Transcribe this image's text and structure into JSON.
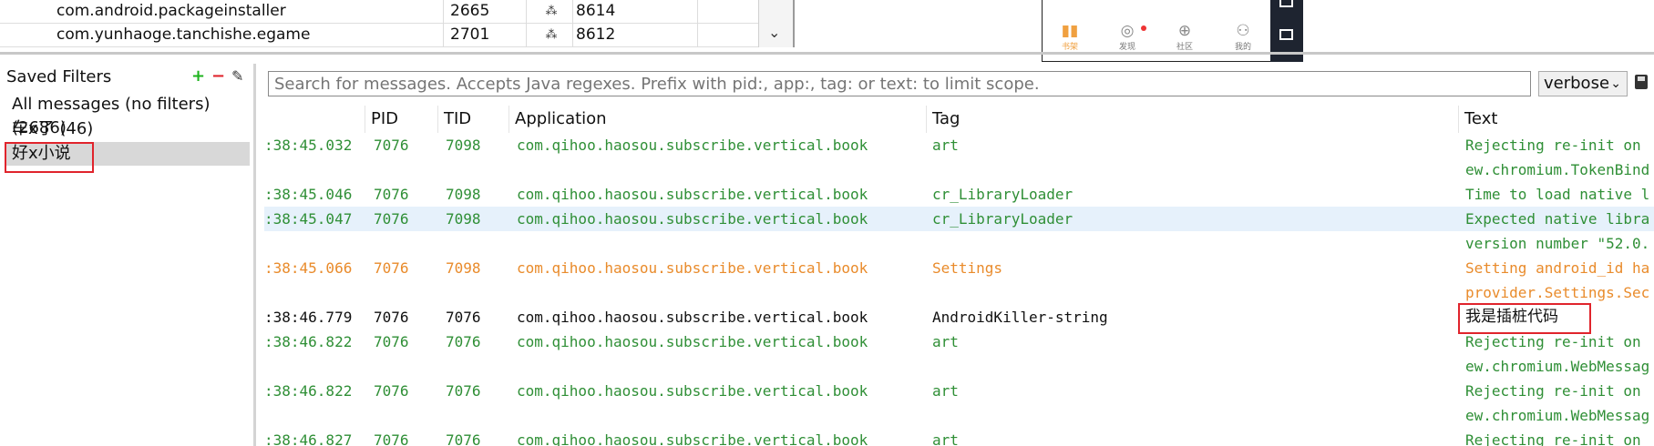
{
  "process_table": {
    "rows": [
      {
        "name": "com.android.packageinstaller",
        "pid": "2665",
        "port": "8614"
      },
      {
        "name": "com.yunhaoge.tanchishe.egame",
        "pid": "2701",
        "port": "8612"
      }
    ]
  },
  "phone": {
    "tabs": [
      {
        "label": "书架",
        "icon": "bookshelf-icon"
      },
      {
        "label": "发现",
        "icon": "compass-icon"
      },
      {
        "label": "社区",
        "icon": "community-icon"
      },
      {
        "label": "我的",
        "icon": "profile-icon"
      }
    ]
  },
  "filters": {
    "title": "Saved Filters",
    "add": "+",
    "remove": "−",
    "items": [
      "All messages (no filters) (2686)",
      "车x了 (46)",
      "好x小说"
    ]
  },
  "search": {
    "placeholder": "Search for messages. Accepts Java regexes. Prefix with pid:, app:, tag: or text: to limit scope."
  },
  "level": {
    "selected": "verbose"
  },
  "log": {
    "columns": [
      "PID",
      "TID",
      "Application",
      "Tag",
      "Text"
    ],
    "rows": [
      {
        "time": ":38:45.032",
        "pid": "7076",
        "tid": "7098",
        "app": "com.qihoo.haosou.subscribe.vertical.book",
        "tag": "art",
        "text": "Rejecting re-init on"
      },
      {
        "time": "",
        "pid": "",
        "tid": "",
        "app": "",
        "tag": "",
        "text": "ew.chromium.TokenBind"
      },
      {
        "time": ":38:45.046",
        "pid": "7076",
        "tid": "7098",
        "app": "com.qihoo.haosou.subscribe.vertical.book",
        "tag": "cr_LibraryLoader",
        "text": "Time to load native l"
      },
      {
        "time": ":38:45.047",
        "pid": "7076",
        "tid": "7098",
        "app": "com.qihoo.haosou.subscribe.vertical.book",
        "tag": "cr_LibraryLoader",
        "text": "Expected native libra"
      },
      {
        "time": "",
        "pid": "",
        "tid": "",
        "app": "",
        "tag": "",
        "text": "version number \"52.0."
      },
      {
        "time": ":38:45.066",
        "pid": "7076",
        "tid": "7098",
        "app": "com.qihoo.haosou.subscribe.vertical.book",
        "tag": "Settings",
        "text": "Setting android_id ha"
      },
      {
        "time": "",
        "pid": "",
        "tid": "",
        "app": "",
        "tag": "",
        "text": "provider.Settings.Sec"
      },
      {
        "time": ":38:46.779",
        "pid": "7076",
        "tid": "7076",
        "app": "com.qihoo.haosou.subscribe.vertical.book",
        "tag": "AndroidKiller-string",
        "text": "我是插桩代码"
      },
      {
        "time": ":38:46.822",
        "pid": "7076",
        "tid": "7076",
        "app": "com.qihoo.haosou.subscribe.vertical.book",
        "tag": "art",
        "text": "Rejecting re-init on"
      },
      {
        "time": "",
        "pid": "",
        "tid": "",
        "app": "",
        "tag": "",
        "text": "ew.chromium.WebMessag"
      },
      {
        "time": ":38:46.822",
        "pid": "7076",
        "tid": "7076",
        "app": "com.qihoo.haosou.subscribe.vertical.book",
        "tag": "art",
        "text": "Rejecting re-init on"
      },
      {
        "time": "",
        "pid": "",
        "tid": "",
        "app": "",
        "tag": "",
        "text": "ew.chromium.WebMessag"
      },
      {
        "time": ":38:46.827",
        "pid": "7076",
        "tid": "7076",
        "app": "com.qihoo.haosou.subscribe.vertical.book",
        "tag": "art",
        "text": "Rejecting re-init on"
      }
    ]
  },
  "colors": {
    "verbose": "#2f8f36",
    "warning": "#e98b2b",
    "info": "#111111",
    "highlight": "#e6f1fb",
    "annotation": "#e0242c"
  }
}
